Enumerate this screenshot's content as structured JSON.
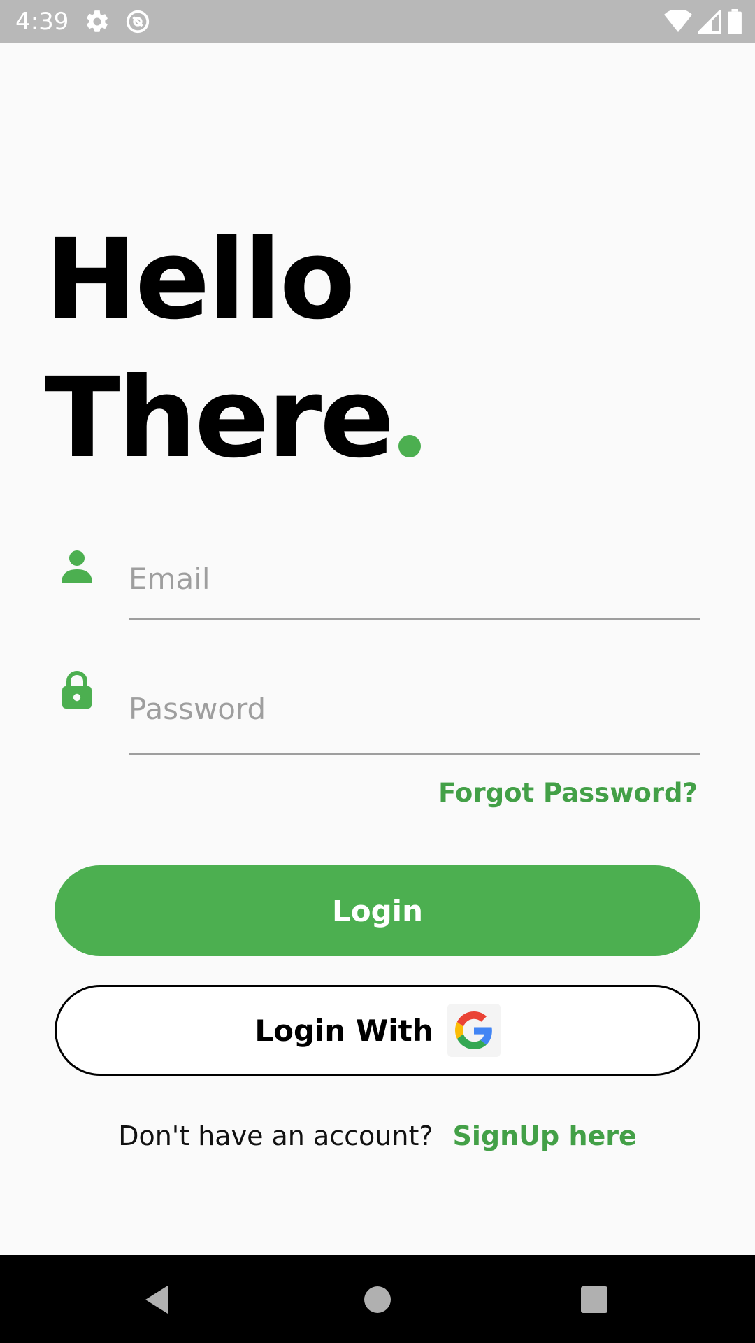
{
  "status_bar": {
    "time": "4:39",
    "icons": [
      "gear-icon",
      "sync-icon",
      "wifi-icon",
      "signal-icon",
      "battery-icon"
    ]
  },
  "heading": {
    "line1": "Hello",
    "line2": "There",
    "accent_color": "#4caf50"
  },
  "form": {
    "email": {
      "icon": "person-icon",
      "placeholder": "Email",
      "value": ""
    },
    "password": {
      "icon": "lock-icon",
      "placeholder": "Password",
      "value": ""
    },
    "forgot_password": "Forgot Password?"
  },
  "buttons": {
    "login": "Login",
    "login_with": "Login With",
    "login_with_icon": "google-icon"
  },
  "signup": {
    "prompt": "Don't have an account?",
    "link": "SignUp here"
  },
  "navigation": {
    "icons": [
      "back-icon",
      "home-icon",
      "recents-icon"
    ]
  },
  "colors": {
    "primary": "#4caf50",
    "link": "#43a047",
    "background": "#fafafa",
    "status_bar": "#b8b8b8",
    "nav_bar": "#000000"
  }
}
